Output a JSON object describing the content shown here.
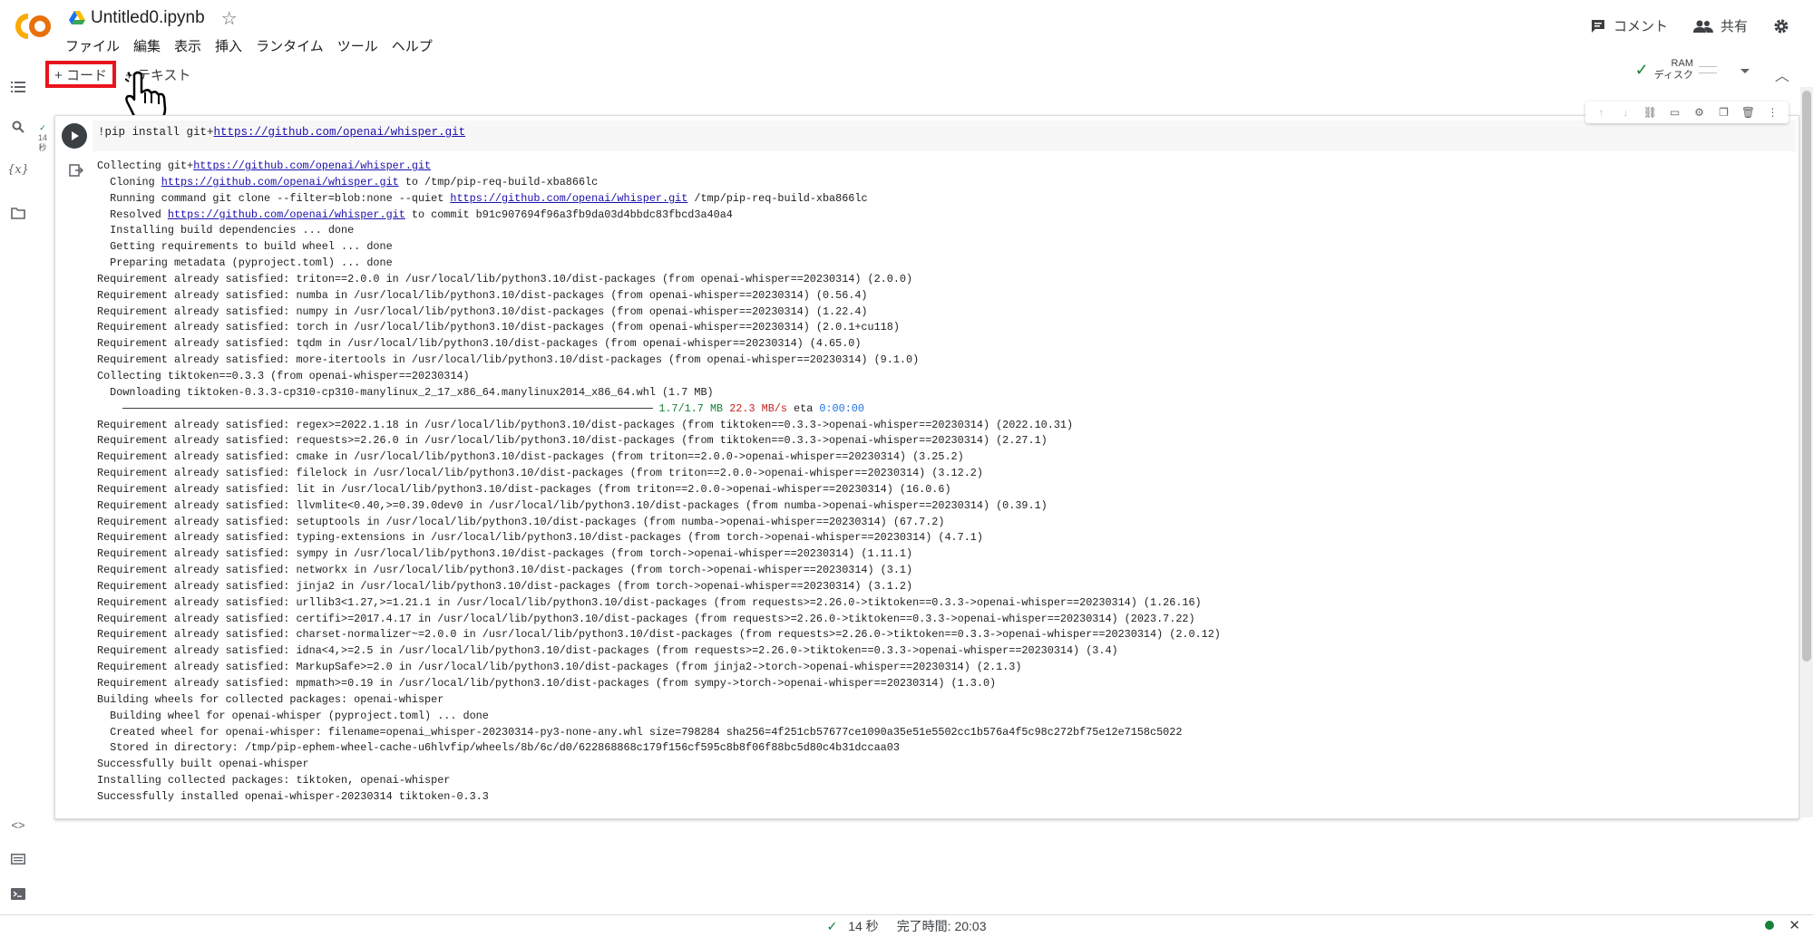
{
  "header": {
    "title": "Untitled0.ipynb",
    "menu": [
      "ファイル",
      "編集",
      "表示",
      "挿入",
      "ランタイム",
      "ツール",
      "ヘルプ"
    ],
    "comment_label": "コメント",
    "share_label": "共有"
  },
  "toolbar": {
    "add_code": "+ コード",
    "add_text": "+ テキスト",
    "ram_label": "RAM",
    "disk_label": "ディスク"
  },
  "cell": {
    "exec_time": "14",
    "exec_unit": "秒",
    "code_prefix": "!pip install git+",
    "code_link": "https://github.com/openai/whisper.git"
  },
  "output": {
    "lines": [
      "Collecting git+https://github.com/openai/whisper.git",
      "  Cloning https://github.com/openai/whisper.git to /tmp/pip-req-build-xba866lc",
      "  Running command git clone --filter=blob:none --quiet https://github.com/openai/whisper.git /tmp/pip-req-build-xba866lc",
      "  Resolved https://github.com/openai/whisper.git to commit b91c907694f96a3fb9da03d4bbdc83fbcd3a40a4",
      "  Installing build dependencies ... done",
      "  Getting requirements to build wheel ... done",
      "  Preparing metadata (pyproject.toml) ... done",
      "Requirement already satisfied: triton==2.0.0 in /usr/local/lib/python3.10/dist-packages (from openai-whisper==20230314) (2.0.0)",
      "Requirement already satisfied: numba in /usr/local/lib/python3.10/dist-packages (from openai-whisper==20230314) (0.56.4)",
      "Requirement already satisfied: numpy in /usr/local/lib/python3.10/dist-packages (from openai-whisper==20230314) (1.22.4)",
      "Requirement already satisfied: torch in /usr/local/lib/python3.10/dist-packages (from openai-whisper==20230314) (2.0.1+cu118)",
      "Requirement already satisfied: tqdm in /usr/local/lib/python3.10/dist-packages (from openai-whisper==20230314) (4.65.0)",
      "Requirement already satisfied: more-itertools in /usr/local/lib/python3.10/dist-packages (from openai-whisper==20230314) (9.1.0)",
      "Collecting tiktoken==0.3.3 (from openai-whisper==20230314)",
      "  Downloading tiktoken-0.3.3-cp310-cp310-manylinux_2_17_x86_64.manylinux2014_x86_64.whl (1.7 MB)"
    ],
    "progress": {
      "size": "1.7/1.7 MB",
      "speed": "22.3 MB/s",
      "eta_label": "eta",
      "eta": "0:00:00"
    },
    "lines2": [
      "Requirement already satisfied: regex>=2022.1.18 in /usr/local/lib/python3.10/dist-packages (from tiktoken==0.3.3->openai-whisper==20230314) (2022.10.31)",
      "Requirement already satisfied: requests>=2.26.0 in /usr/local/lib/python3.10/dist-packages (from tiktoken==0.3.3->openai-whisper==20230314) (2.27.1)",
      "Requirement already satisfied: cmake in /usr/local/lib/python3.10/dist-packages (from triton==2.0.0->openai-whisper==20230314) (3.25.2)",
      "Requirement already satisfied: filelock in /usr/local/lib/python3.10/dist-packages (from triton==2.0.0->openai-whisper==20230314) (3.12.2)",
      "Requirement already satisfied: lit in /usr/local/lib/python3.10/dist-packages (from triton==2.0.0->openai-whisper==20230314) (16.0.6)",
      "Requirement already satisfied: llvmlite<0.40,>=0.39.0dev0 in /usr/local/lib/python3.10/dist-packages (from numba->openai-whisper==20230314) (0.39.1)",
      "Requirement already satisfied: setuptools in /usr/local/lib/python3.10/dist-packages (from numba->openai-whisper==20230314) (67.7.2)",
      "Requirement already satisfied: typing-extensions in /usr/local/lib/python3.10/dist-packages (from torch->openai-whisper==20230314) (4.7.1)",
      "Requirement already satisfied: sympy in /usr/local/lib/python3.10/dist-packages (from torch->openai-whisper==20230314) (1.11.1)",
      "Requirement already satisfied: networkx in /usr/local/lib/python3.10/dist-packages (from torch->openai-whisper==20230314) (3.1)",
      "Requirement already satisfied: jinja2 in /usr/local/lib/python3.10/dist-packages (from torch->openai-whisper==20230314) (3.1.2)",
      "Requirement already satisfied: urllib3<1.27,>=1.21.1 in /usr/local/lib/python3.10/dist-packages (from requests>=2.26.0->tiktoken==0.3.3->openai-whisper==20230314) (1.26.16)",
      "Requirement already satisfied: certifi>=2017.4.17 in /usr/local/lib/python3.10/dist-packages (from requests>=2.26.0->tiktoken==0.3.3->openai-whisper==20230314) (2023.7.22)",
      "Requirement already satisfied: charset-normalizer~=2.0.0 in /usr/local/lib/python3.10/dist-packages (from requests>=2.26.0->tiktoken==0.3.3->openai-whisper==20230314) (2.0.12)",
      "Requirement already satisfied: idna<4,>=2.5 in /usr/local/lib/python3.10/dist-packages (from requests>=2.26.0->tiktoken==0.3.3->openai-whisper==20230314) (3.4)",
      "Requirement already satisfied: MarkupSafe>=2.0 in /usr/local/lib/python3.10/dist-packages (from jinja2->torch->openai-whisper==20230314) (2.1.3)",
      "Requirement already satisfied: mpmath>=0.19 in /usr/local/lib/python3.10/dist-packages (from sympy->torch->openai-whisper==20230314) (1.3.0)",
      "Building wheels for collected packages: openai-whisper",
      "  Building wheel for openai-whisper (pyproject.toml) ... done",
      "  Created wheel for openai-whisper: filename=openai_whisper-20230314-py3-none-any.whl size=798284 sha256=4f251cb57677ce1090a35e51e5502cc1b576a4f5c98c272bf75e12e7158c5022",
      "  Stored in directory: /tmp/pip-ephem-wheel-cache-u6hlvfip/wheels/8b/6c/d0/622868868c179f156cf595c8b8f06f88bc5d80c4b31dccaa03",
      "Successfully built openai-whisper",
      "Installing collected packages: tiktoken, openai-whisper",
      "Successfully installed openai-whisper-20230314 tiktoken-0.3.3"
    ]
  },
  "status": {
    "time": "14 秒",
    "completed": "完了時間: 20:03"
  },
  "colors": {
    "accent_red": "#e8141c",
    "logo_orange": "#f9ab00",
    "logo_dark_orange": "#e8710a",
    "ok_green": "#188038"
  }
}
